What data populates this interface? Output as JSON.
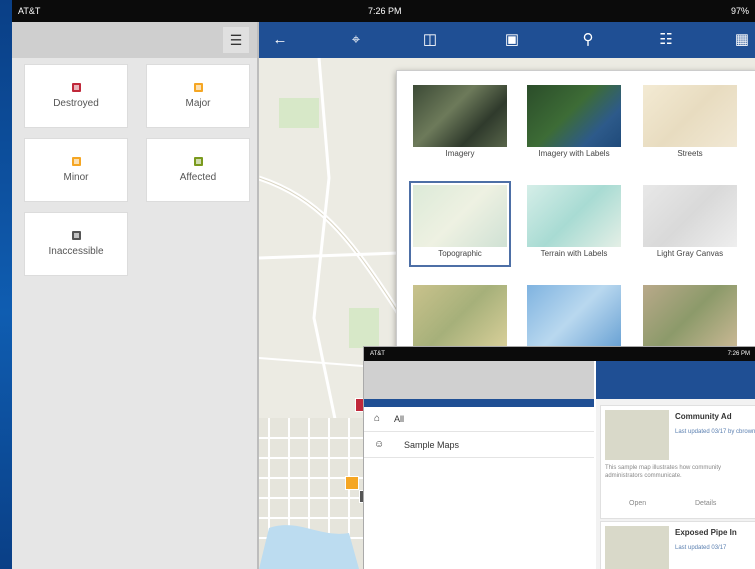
{
  "status": {
    "carrier": "AT&T",
    "time": "7:26 PM",
    "battery": "97%"
  },
  "left_pane": {
    "categories": [
      {
        "label": "Destroyed",
        "color": "#c0283a"
      },
      {
        "label": "Major",
        "color": "#f5a623"
      },
      {
        "label": "Minor",
        "color": "#f5a623"
      },
      {
        "label": "Affected",
        "color": "#7a9a1e"
      },
      {
        "label": "Inaccessible",
        "color": "#555555"
      }
    ]
  },
  "toolbar": {
    "icons": [
      "back-arrow-icon",
      "locate-icon",
      "bookmarks-icon",
      "layers-icon",
      "search-icon",
      "basemap-icon",
      "qr-code-icon"
    ]
  },
  "basemap_gallery": {
    "items": [
      {
        "label": "Imagery"
      },
      {
        "label": "Imagery with Labels"
      },
      {
        "label": "Streets"
      },
      {
        "label": "Topographic",
        "selected": true
      },
      {
        "label": "Terrain with Labels"
      },
      {
        "label": "Light Gray Canvas"
      },
      {
        "label": ""
      },
      {
        "label": ""
      },
      {
        "label": ""
      }
    ]
  },
  "inset_app": {
    "status": {
      "carrier": "AT&T",
      "time": "7:26 PM"
    },
    "list": [
      {
        "label": "All"
      },
      {
        "label": "Sample Maps"
      }
    ],
    "items": [
      {
        "title": "Community Ad",
        "meta": "Last updated 03/17 by cbrown",
        "desc": "This sample map illustrates how community administrators communicate."
      },
      {
        "title": "Exposed Pipe In",
        "meta": "Last updated 03/17",
        "desc": ""
      }
    ],
    "buttons": [
      "Open",
      "Details"
    ]
  }
}
